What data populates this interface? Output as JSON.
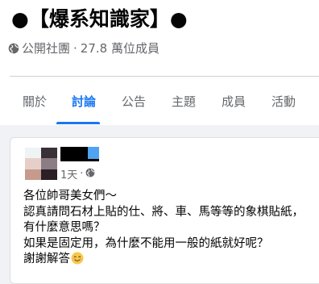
{
  "group": {
    "title": "●【爆系知識家】●",
    "privacy": "公開社團",
    "separator": "·",
    "members": "27.8 萬位成員"
  },
  "tabs": [
    "關於",
    "討論",
    "公告",
    "主題",
    "成員",
    "活動"
  ],
  "active_tab": "討論",
  "post": {
    "time": "1天",
    "dot": "·",
    "lines": [
      "各位帥哥美女們～",
      "認真請問石材上貼的仕、將、車、馬等等的象棋貼紙，",
      "有什麼意思嗎？",
      "如果是固定用，為什麼不能用一般的紙就好呢？",
      "謝謝解答"
    ],
    "emoji": "smiling-face-icon"
  },
  "colors": {
    "accent": "#1877f2",
    "muted": "#65676b",
    "page_bg": "#f0f2f5"
  }
}
